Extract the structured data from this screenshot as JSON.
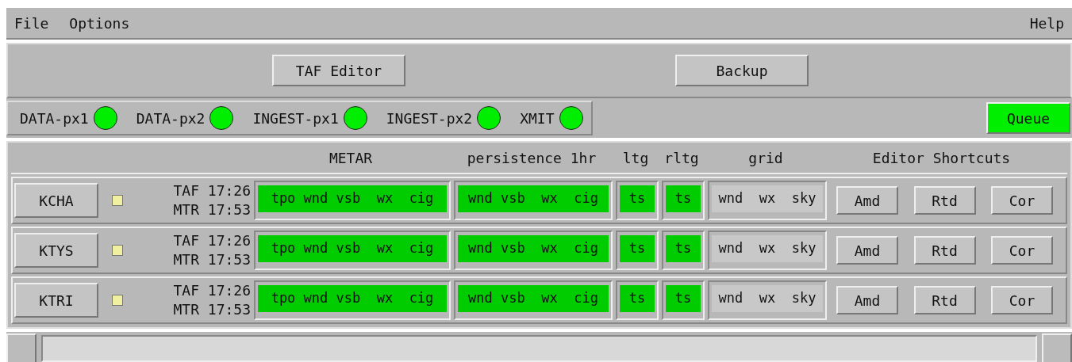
{
  "menu": [
    "File",
    "Options"
  ],
  "help": "Help",
  "toolbar": [
    "TAF Editor",
    "Backup"
  ],
  "servers": [
    {
      "label": "DATA-px1",
      "color": "#00ee00"
    },
    {
      "label": "DATA-px2",
      "color": "#00ee00"
    },
    {
      "label": "INGEST-px1",
      "color": "#00ee00"
    },
    {
      "label": "INGEST-px2",
      "color": "#00ee00"
    },
    {
      "label": "XMIT",
      "color": "#00ee00"
    }
  ],
  "queue": {
    "label": "Queue",
    "color": "#00ee00"
  },
  "columns": [
    "METAR",
    "persistence 1hr",
    "ltg",
    "rltg",
    "grid",
    "Editor Shortcuts"
  ],
  "rows": [
    {
      "station": "KCHA",
      "color": "#f0f0a0",
      "taf": "TAF 17:26",
      "mtr": "MTR 17:53",
      "cells": [
        {
          "text": "tpo wnd vsb  wx  cig",
          "color": "#00cc00"
        },
        {
          "text": "wnd vsb  wx  cig",
          "color": "#00cc00"
        },
        {
          "text": "ts",
          "color": "#00cc00"
        },
        {
          "text": "ts",
          "color": "#00cc00"
        },
        {
          "text": "wnd  wx  sky",
          "color": "#c8c8c8"
        }
      ],
      "shortcuts": [
        "Amd",
        "Rtd",
        "Cor"
      ]
    },
    {
      "station": "KTYS",
      "color": "#f0f0a0",
      "taf": "TAF 17:26",
      "mtr": "MTR 17:53",
      "cells": [
        {
          "text": "tpo wnd vsb  wx  cig",
          "color": "#00cc00"
        },
        {
          "text": "wnd vsb  wx  cig",
          "color": "#00cc00"
        },
        {
          "text": "ts",
          "color": "#00cc00"
        },
        {
          "text": "ts",
          "color": "#00cc00"
        },
        {
          "text": "wnd  wx  sky",
          "color": "#c8c8c8"
        }
      ],
      "shortcuts": [
        "Amd",
        "Rtd",
        "Cor"
      ]
    },
    {
      "station": "KTRI",
      "color": "#f0f0a0",
      "taf": "TAF 17:26",
      "mtr": "MTR 17:53",
      "cells": [
        {
          "text": "tpo wnd vsb  wx  cig",
          "color": "#00cc00"
        },
        {
          "text": "wnd vsb  wx  cig",
          "color": "#00cc00"
        },
        {
          "text": "ts",
          "color": "#00cc00"
        },
        {
          "text": "ts",
          "color": "#00cc00"
        },
        {
          "text": "wnd  wx  sky",
          "color": "#c8c8c8"
        }
      ],
      "shortcuts": [
        "Amd",
        "Rtd",
        "Cor"
      ]
    }
  ]
}
